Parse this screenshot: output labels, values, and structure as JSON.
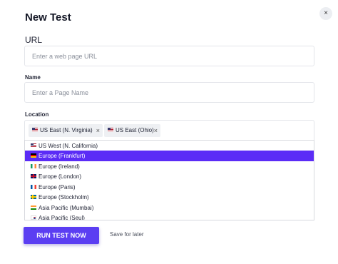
{
  "modal": {
    "title": "New Test",
    "close_label": "×"
  },
  "url_field": {
    "label": "URL",
    "placeholder": "Enter a web page URL",
    "value": ""
  },
  "name_field": {
    "label": "Name",
    "placeholder": "Enter a Page Name",
    "value": ""
  },
  "location": {
    "label": "Location",
    "selected_chips": [
      {
        "label": "US East (N. Virginia)",
        "flag": "us",
        "remove_label": "×"
      },
      {
        "label": "US East (Ohio)",
        "flag": "us",
        "remove_label": "×"
      }
    ],
    "options": [
      {
        "label": "US West (N. California)",
        "flag": "us",
        "highlighted": false
      },
      {
        "label": "Europe (Frankfurt)",
        "flag": "de",
        "highlighted": true
      },
      {
        "label": "Europe (Ireland)",
        "flag": "ie",
        "highlighted": false
      },
      {
        "label": "Europe (London)",
        "flag": "gb",
        "highlighted": false
      },
      {
        "label": "Europe (Paris)",
        "flag": "fr",
        "highlighted": false
      },
      {
        "label": "Europe (Stockholm)",
        "flag": "se",
        "highlighted": false
      },
      {
        "label": "Asia Pacific (Mumbai)",
        "flag": "in",
        "highlighted": false
      },
      {
        "label": "Asia Pacific (Seul)",
        "flag": "kr",
        "highlighted": false
      }
    ]
  },
  "actions": {
    "run_label": "RUN TEST NOW",
    "save_label": "Save for later"
  },
  "colors": {
    "accent": "#5b3ef2",
    "highlight": "#5b2cf6"
  }
}
